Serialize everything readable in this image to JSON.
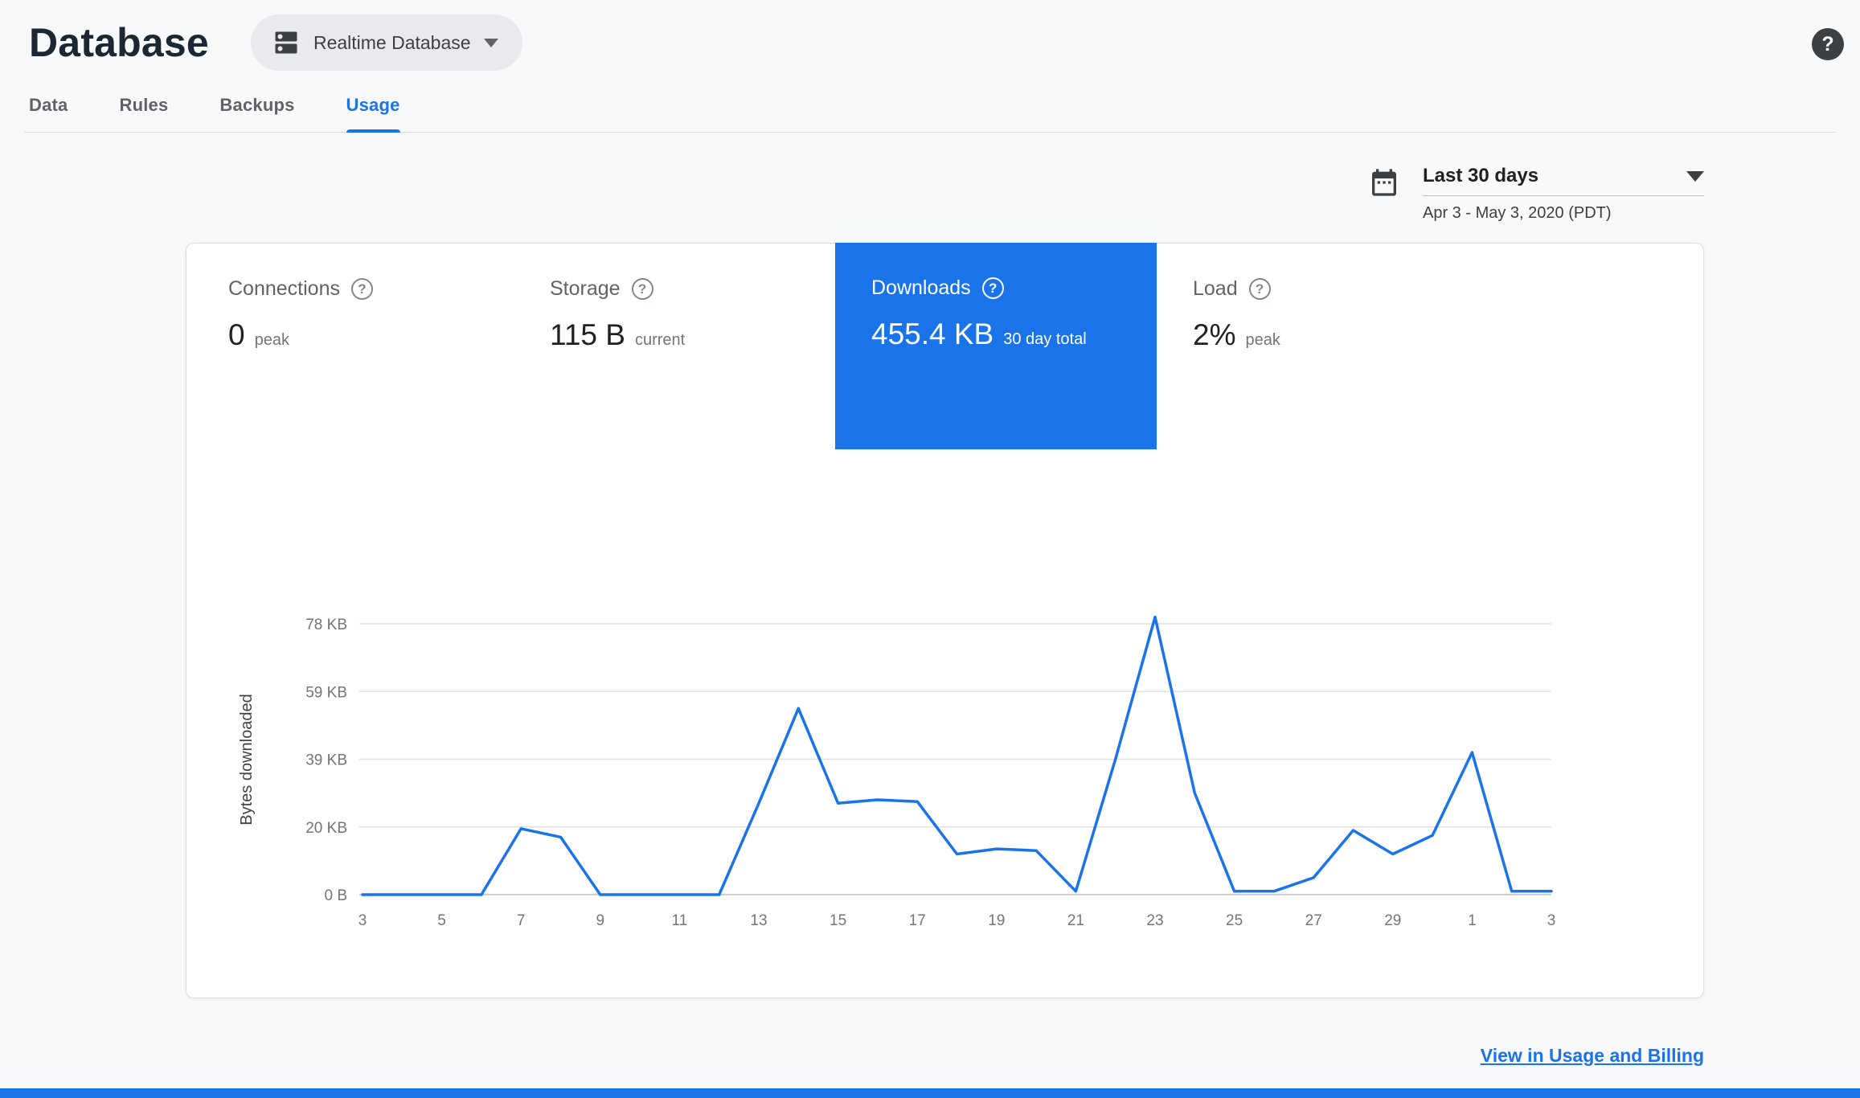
{
  "header": {
    "title": "Database",
    "db_selector_label": "Realtime Database",
    "help_icon": "help-icon"
  },
  "tabs": [
    {
      "label": "Data",
      "active": false
    },
    {
      "label": "Rules",
      "active": false
    },
    {
      "label": "Backups",
      "active": false
    },
    {
      "label": "Usage",
      "active": true
    }
  ],
  "date_range": {
    "label": "Last 30 days",
    "sublabel": "Apr 3 - May 3, 2020 (PDT)",
    "calendar_icon": "calendar-icon"
  },
  "metrics": [
    {
      "label": "Connections",
      "value": "0",
      "unit": "peak",
      "selected": false
    },
    {
      "label": "Storage",
      "value": "115 B",
      "unit": "current",
      "selected": false
    },
    {
      "label": "Downloads",
      "value": "455.4 KB",
      "unit": "30 day total",
      "selected": true
    },
    {
      "label": "Load",
      "value": "2%",
      "unit": "peak",
      "selected": false
    }
  ],
  "chart_data": {
    "type": "line",
    "title": "Downloads",
    "ylabel": "Bytes downloaded",
    "xlabel": "",
    "x_days": [
      3,
      4,
      5,
      6,
      7,
      8,
      9,
      10,
      11,
      12,
      13,
      14,
      15,
      16,
      17,
      18,
      19,
      20,
      21,
      22,
      23,
      24,
      25,
      26,
      27,
      28,
      29,
      30,
      1,
      2,
      3
    ],
    "values_kb": [
      0,
      0,
      0,
      0,
      19.5,
      17,
      0,
      0,
      0,
      0,
      27,
      55,
      27,
      28,
      27.5,
      12,
      13.5,
      13,
      1,
      40,
      82,
      30,
      1,
      1,
      5,
      19,
      12,
      17.5,
      42,
      1,
      1
    ],
    "x_tick_labels": [
      "3",
      "5",
      "7",
      "9",
      "11",
      "13",
      "15",
      "17",
      "19",
      "21",
      "23",
      "25",
      "27",
      "29",
      "1",
      "3"
    ],
    "y_tick_labels": [
      "78 KB",
      "59 KB",
      "39 KB",
      "20 KB",
      "0 B"
    ],
    "ylim_kb": [
      0,
      80
    ],
    "grid": true,
    "legend": "none",
    "line_color": "#1a73e8"
  },
  "footer": {
    "link": "View in Usage and Billing"
  },
  "colors": {
    "accent": "#1a73e8",
    "selected_tile_bg": "#1a73e8",
    "grid_line": "#e0e0e0",
    "baseline": "#bdc1c6",
    "tick_text": "#757575",
    "bottom_bar": "#1a73e8"
  }
}
